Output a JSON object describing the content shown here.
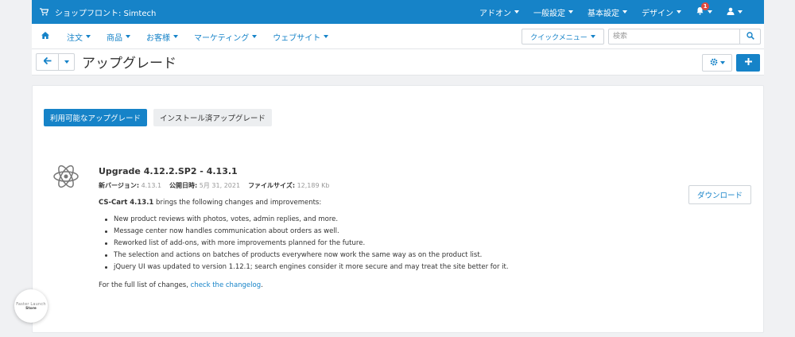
{
  "topbar": {
    "store_name": "ショップフロント: Simtech",
    "menu": [
      {
        "label": "アドオン"
      },
      {
        "label": "一般設定"
      },
      {
        "label": "基本設定"
      },
      {
        "label": "デザイン"
      }
    ],
    "notification_count": "1"
  },
  "subnav": {
    "menu": [
      {
        "label": "注文"
      },
      {
        "label": "商品"
      },
      {
        "label": "お客様"
      },
      {
        "label": "マーケティング"
      },
      {
        "label": "ウェブサイト"
      }
    ],
    "quick_menu_label": "クイックメニュー",
    "search_placeholder": "検索"
  },
  "page": {
    "title": "アップグレード"
  },
  "tabs": [
    {
      "label": "利用可能なアップグレード",
      "active": true
    },
    {
      "label": "インストール済アップグレード",
      "active": false
    }
  ],
  "upgrade": {
    "title": "Upgrade 4.12.2.SP2 - 4.13.1",
    "version_label": "新バージョン:",
    "version_value": "4.13.1",
    "date_label": "公開日時:",
    "date_value": "5月 31, 2021",
    "size_label": "ファイルサイズ:",
    "size_value": "12,189 Kb",
    "intro_product": "CS-Cart 4.13.1",
    "intro_text": " brings the following changes and improvements:",
    "changes": [
      "New product reviews with photos, votes, admin replies, and more.",
      "Message center now handles communication about orders as well.",
      "Reworked list of add-ons, with more improvements planned for the future.",
      "The selection and actions on batches of products everywhere now work the same way as on the product list.",
      "jQuery UI was updated to version 1.12.1; search engines consider it more secure and may treat the site better for it."
    ],
    "footer_text": "For the full list of changes, ",
    "footer_link": "check the changelog",
    "footer_end": ".",
    "download_label": "ダウンロード"
  },
  "store_badge": {
    "line1": "Faster Launch",
    "line2": "Store"
  },
  "colors": {
    "primary": "#1683c8",
    "badge": "#e0483e",
    "background": "#f0f1f3"
  },
  "icons": [
    "cart-icon",
    "bell-icon",
    "user-icon",
    "home-icon",
    "search-icon",
    "arrow-left-icon",
    "gear-icon",
    "plus-icon",
    "atom-icon"
  ]
}
